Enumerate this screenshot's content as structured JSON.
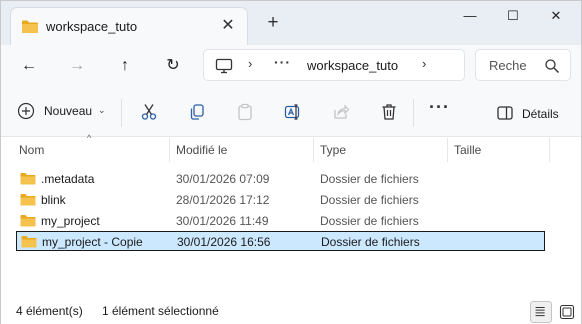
{
  "window": {
    "tab_title": "workspace_tuto",
    "icons": {
      "tab_folder": "folder-icon",
      "tab_close": "close-icon",
      "new_tab": "plus-icon",
      "minimize": "minimize-icon",
      "maximize": "maximize-icon",
      "close": "close-icon"
    },
    "glyphs": {
      "tab_close": "✕",
      "new_tab": "+",
      "minimize": "—",
      "maximize": "☐",
      "close": "✕"
    }
  },
  "nav": {
    "glyphs": {
      "back": "←",
      "forward": "→",
      "up": "↑",
      "refresh": "↻",
      "chevron": "›",
      "ellipsis": "···"
    },
    "address": {
      "current_folder": "workspace_tuto"
    },
    "search": {
      "placeholder": "Reche"
    }
  },
  "commands": {
    "new_label": "Nouveau",
    "new_chevron": "⌄",
    "more": "···",
    "details_label": "Détails",
    "icons": [
      "cut-icon",
      "copy-icon",
      "paste-icon",
      "rename-icon",
      "share-icon",
      "delete-icon"
    ]
  },
  "list": {
    "sort_indicator": "^",
    "columns": {
      "name": "Nom",
      "modified": "Modifié le",
      "type": "Type",
      "size": "Taille"
    },
    "rows": [
      {
        "name": ".metadata",
        "modified": "30/01/2026 07:09",
        "type": "Dossier de fichiers",
        "size": ""
      },
      {
        "name": "blink",
        "modified": "28/01/2026 17:12",
        "type": "Dossier de fichiers",
        "size": ""
      },
      {
        "name": "my_project",
        "modified": "30/01/2026 11:49",
        "type": "Dossier de fichiers",
        "size": ""
      },
      {
        "name": "my_project - Copie",
        "modified": "30/01/2026 16:56",
        "type": "Dossier de fichiers",
        "size": "",
        "selected": true
      }
    ]
  },
  "status": {
    "item_count": "4 élément(s)",
    "selection": "1 élément sélectionné"
  },
  "colors": {
    "folder": "#f4c24d",
    "folder_tab": "#e9a91e",
    "selection_bg": "#cce8ff",
    "titlebar_bg": "#e9eef5",
    "accent": "#0067c0"
  }
}
